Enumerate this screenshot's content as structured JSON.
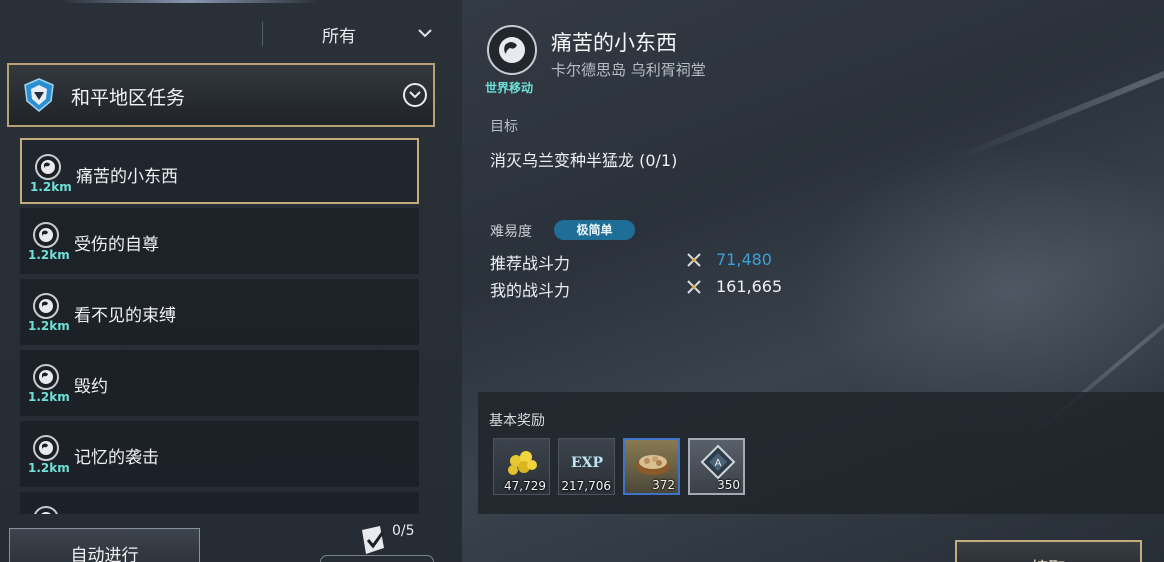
{
  "filter": {
    "selected": "所有"
  },
  "category": {
    "title": "和平地区任务"
  },
  "quests": [
    {
      "name": "痛苦的小东西",
      "distance": "1.2km",
      "selected": true
    },
    {
      "name": "受伤的自尊",
      "distance": "1.2km",
      "selected": false
    },
    {
      "name": "看不见的束缚",
      "distance": "1.2km",
      "selected": false
    },
    {
      "name": "毁约",
      "distance": "1.2km",
      "selected": false
    },
    {
      "name": "记忆的袭击",
      "distance": "1.2km",
      "selected": false
    }
  ],
  "footer": {
    "auto_label": "自动进行",
    "progress": "0/5"
  },
  "detail": {
    "type_label": "世界移动",
    "title": "痛苦的小东西",
    "location": "卡尔德思岛 乌利胥祠堂",
    "objective_label": "目标",
    "objective_text": "消灭乌兰变种半猛龙   (0/1)",
    "difficulty_label": "难易度",
    "difficulty_value": "极简单",
    "recommended_label": "推荐战斗力",
    "recommended_value": "71,480",
    "my_power_label": "我的战斗力",
    "my_power_value": "161,665",
    "recommended_color": "#3aa0d8"
  },
  "rewards": {
    "label": "基本奖励",
    "items": [
      {
        "icon": "gold-coins-icon",
        "qty": "47,729"
      },
      {
        "icon": "exp-icon",
        "qty": "217,706",
        "text": "EXP"
      },
      {
        "icon": "food-basket-icon",
        "qty": "372"
      },
      {
        "icon": "emblem-token-icon",
        "qty": "350"
      }
    ]
  },
  "accept": {
    "label": "接取"
  }
}
